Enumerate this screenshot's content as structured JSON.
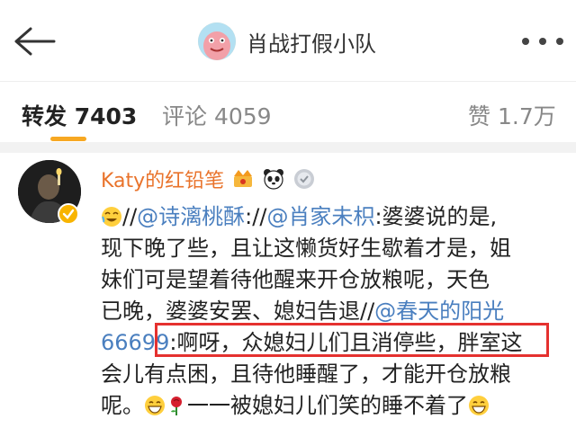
{
  "header": {
    "title": "肖战打假小队"
  },
  "tabs": {
    "repost_label": "转发",
    "repost_count": "7403",
    "comment_label": "评论",
    "comment_count": "4059",
    "like_label": "赞",
    "like_count": "1.7万"
  },
  "post": {
    "username": "Katy的红铅笔",
    "lines": [
      {
        "a": "//",
        "m1": "@诗漓桃酥",
        "b": "://",
        "m2": "@肖家未枳",
        "c": ":婆婆说的是,"
      },
      {
        "text": "现下晚了些，且让这懒货好生歇着才是，姐"
      },
      {
        "text": "妹们可是望着待他醒来开仓放粮呢，天色"
      },
      {
        "a": "已晚，婆婆安罢、媳妇告退//",
        "m1": "@春天的阳光"
      },
      {
        "m1": "66699",
        "b": ":啊呀，众媳妇儿们且消停些，胖室这"
      },
      {
        "text": "会儿有点困，且待他睡醒了，才能开仓放粮"
      },
      {
        "a": "呢。",
        "b": "一一被媳妇儿们笑的睡不着了"
      }
    ]
  },
  "colors": {
    "accent": "#f7a822",
    "username": "#e9732b",
    "mention": "#4a7fbf",
    "highlight": "#e5312f"
  },
  "icons": [
    "back-arrow-icon",
    "more-icon",
    "verified-icon",
    "crown-badge-icon",
    "panda-badge-icon",
    "medal-badge-icon",
    "crying-laughing-emoji",
    "grin-emoji",
    "rose-emoji"
  ]
}
